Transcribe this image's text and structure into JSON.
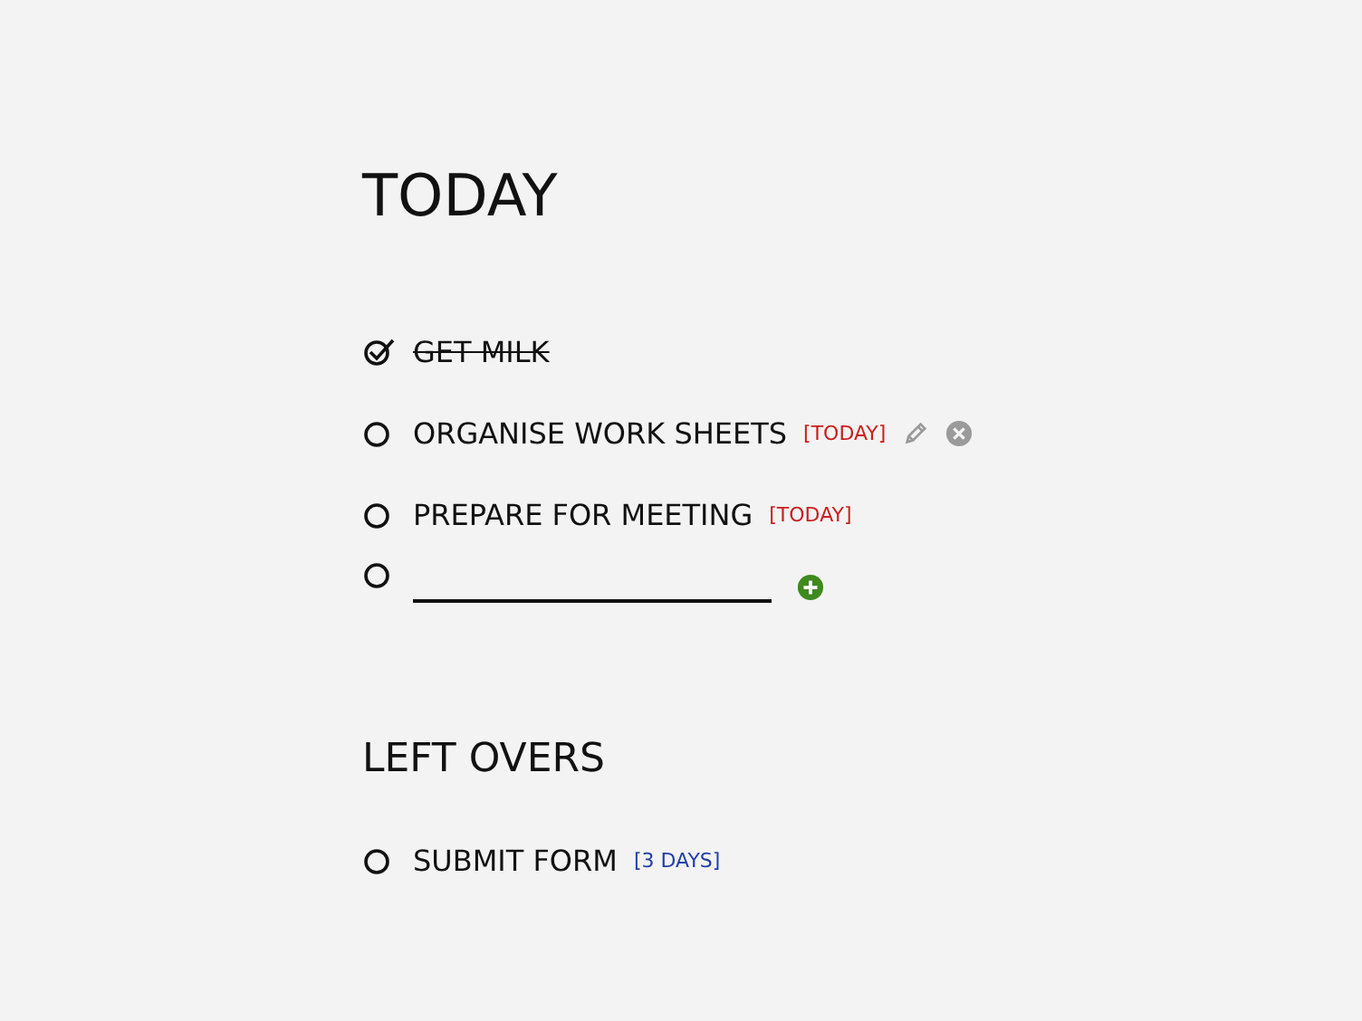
{
  "sections": [
    {
      "title": "TODAY",
      "items": [
        {
          "kind": "task",
          "label": "GET MILK",
          "done": true,
          "show_actions": false
        },
        {
          "kind": "task",
          "label": "ORGANISE WORK SHEETS",
          "done": false,
          "due": "[TODAY]",
          "color": "#c8201e",
          "show_actions": true
        },
        {
          "kind": "task",
          "label": "PREPARE FOR MEETING",
          "done": false,
          "due": "[TODAY]",
          "color": "#c8201e",
          "show_actions": false
        },
        {
          "kind": "new",
          "done": false
        }
      ]
    },
    {
      "title": "LEFT OVERS",
      "items": [
        {
          "kind": "task",
          "label": "SUBMIT FORM",
          "done": false,
          "due": "[3 DAYS]",
          "color": "#1f3fa8",
          "show_actions": false
        }
      ]
    }
  ]
}
